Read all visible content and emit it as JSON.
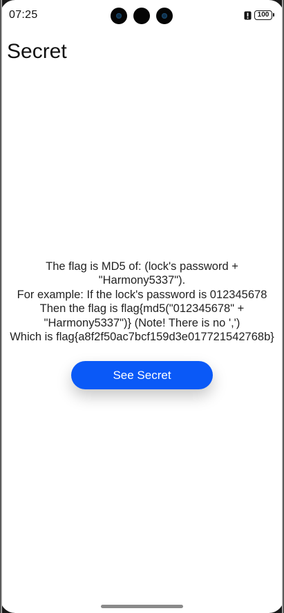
{
  "status_bar": {
    "time": "07:25",
    "battery": "100",
    "alert_icon": "exclamation-icon"
  },
  "header": {
    "title": "Secret"
  },
  "message": {
    "lines": [
      "The flag is MD5 of: (lock's password +",
      "\"Harmony5337\").",
      "For example: If the lock's password is 012345678",
      "Then the flag is flag{md5(\"012345678\" +",
      "\"Harmony5337\")} (Note! There is no ',')",
      "Which is flag{a8f2f50ac7bcf159d3e017721542768b}"
    ]
  },
  "actions": {
    "see_secret_label": "See Secret"
  },
  "colors": {
    "accent": "#0a59f7",
    "background": "#ffffff",
    "text": "#222222"
  }
}
